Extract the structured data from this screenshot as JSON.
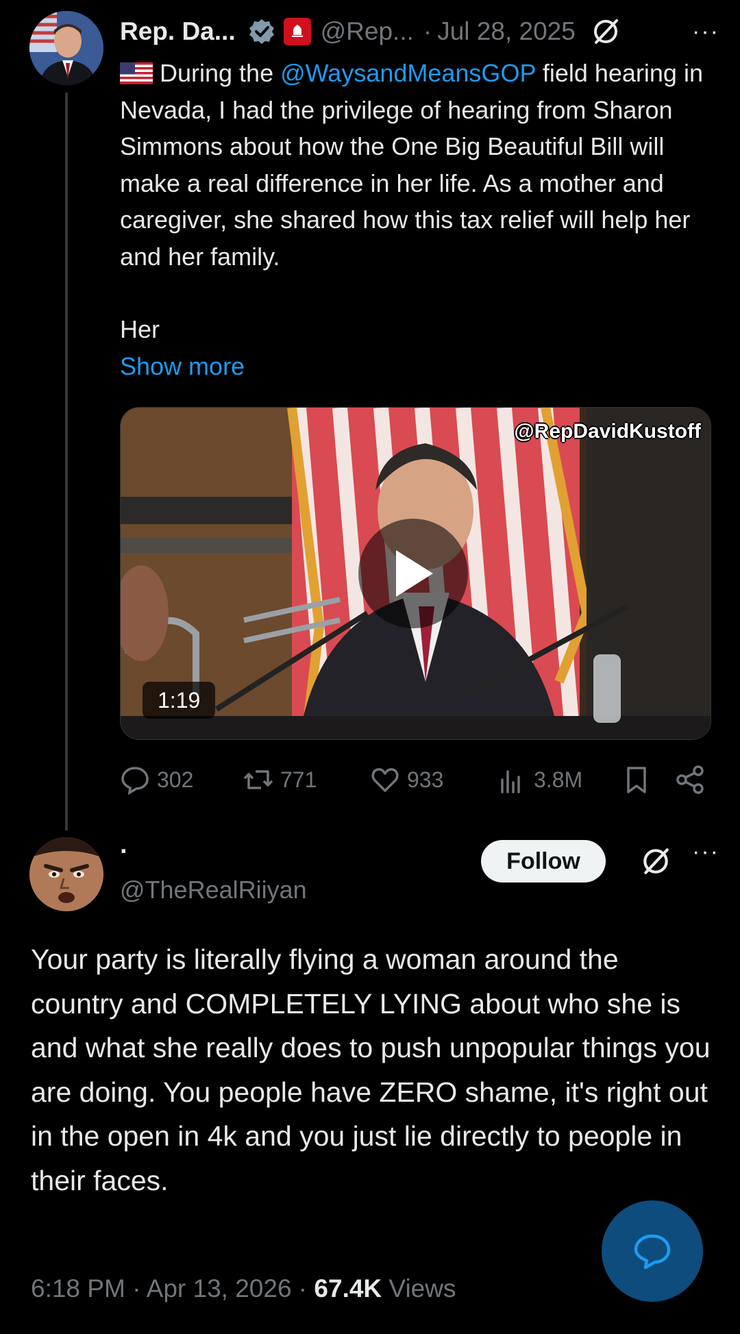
{
  "tweet": {
    "author_name": "Rep. Da...",
    "handle": "@Rep...",
    "separator": "·",
    "date": "Jul 28, 2025",
    "more_label": "···",
    "text_before_mention": "During the ",
    "mention": "@WaysandMeansGOP",
    "text_after_mention": " field hearing in Nevada, I had the privilege of hearing from Sharon Simmons about how the One Big Beautiful Bill will make a real difference in her life. As a mother and caregiver, she shared how this tax relief will help her and her family.",
    "text_continuation": "Her",
    "show_more": "Show more",
    "video": {
      "watermark": "@RepDavidKustoff",
      "duration": "1:19"
    },
    "stats": {
      "replies": "302",
      "reposts": "771",
      "likes": "933",
      "views": "3.8M"
    },
    "icons": [
      "us-flag-icon",
      "verified-badge-icon",
      "government-badge-icon",
      "grok-icon",
      "play-icon",
      "reply-icon",
      "repost-icon",
      "like-icon",
      "views-icon",
      "bookmark-icon",
      "share-icon"
    ]
  },
  "reply": {
    "display_name": "·",
    "handle": "@TheRealRiiyan",
    "follow_label": "Follow",
    "more_label": "···",
    "text": "Your party is literally flying a woman around the country and COMPLETELY LYING about who she is and what she really does to push unpopular things you are doing. You people have ZERO shame, it's right out in the open in 4k and you just lie directly to people in their faces.",
    "time": "6:18 PM",
    "separator1": " · ",
    "date": "Apr 13, 2026",
    "separator2": " · ",
    "views_count": "67.4K",
    "views_label": " Views"
  },
  "colors": {
    "background": "#000000",
    "text": "#e7e9ea",
    "secondary": "#71767b",
    "link": "#1d9bf0",
    "fab": "#0e4c7d"
  }
}
